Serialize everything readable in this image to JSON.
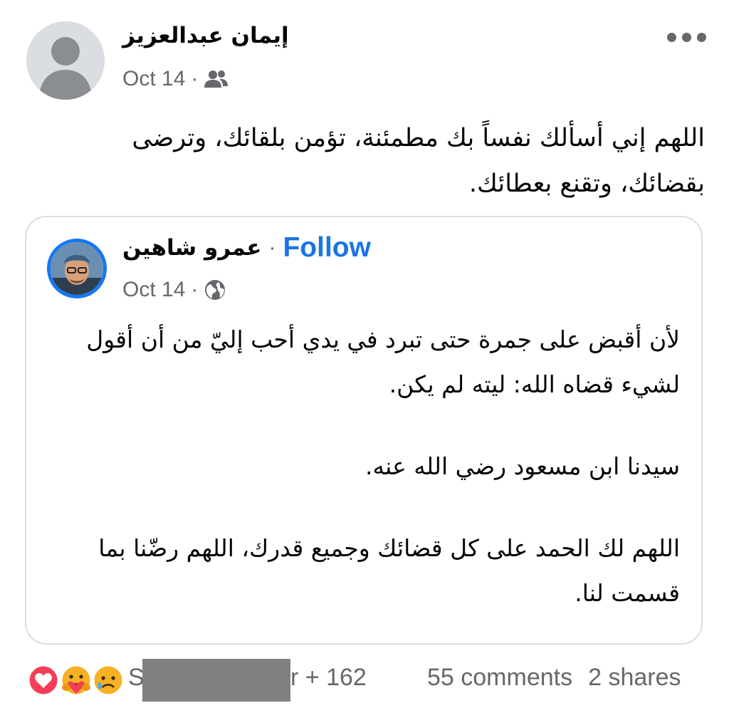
{
  "post": {
    "author": "إيمان عبدالعزيز",
    "date": "Oct 14",
    "separator": "·",
    "audience_icon": "friends-icon",
    "menu_icon": "more-options-icon",
    "text": "اللهم إني أسألك نفساً بك مطمئنة، تؤمن بلقائك، وترضى بقضائك، وتقنع بعطائك."
  },
  "shared_post": {
    "author": "عمرو شاهين",
    "separator": "·",
    "follow_label": "Follow",
    "date": "Oct 14",
    "audience_icon": "globe-icon",
    "paragraphs": [
      "لأن أقبض على جمرة حتى تبرد في يدي أحب إليّ من أن أقول لشيء قضاه الله: ليته لم يكن.",
      "سيدنا ابن مسعود رضي الله عنه.",
      "اللهم لك الحمد على كل قضائك وجميع قدرك، اللهم رضّنا بما قسمت لنا."
    ]
  },
  "footer": {
    "reaction_icons": [
      "love-reaction-icon",
      "care-reaction-icon",
      "sad-reaction-icon"
    ],
    "names_start": "S",
    "names_end": "r + 162",
    "comments": "55 comments",
    "shares": "2 shares"
  },
  "colors": {
    "accent": "#1b74e4",
    "secondary_text": "#65676b",
    "card_border": "#dadde1",
    "avatar_ring": "#1877f2"
  }
}
